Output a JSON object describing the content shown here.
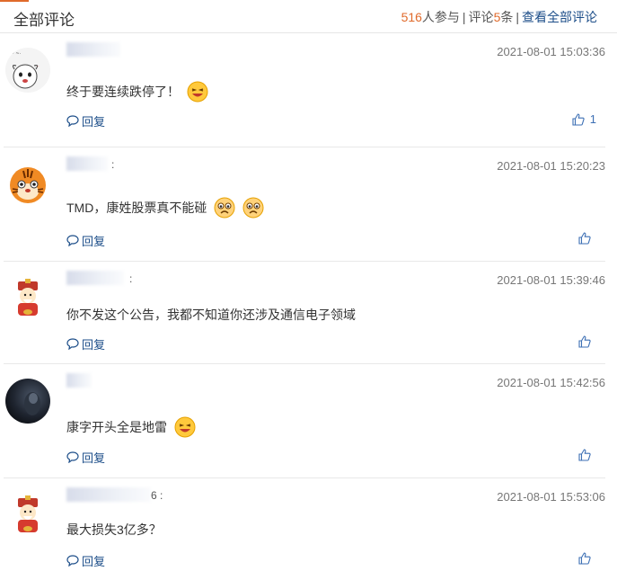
{
  "header": {
    "title": "全部评论",
    "participants": "516",
    "participants_suffix": "人参与",
    "separator": "|",
    "comments_prefix": "评论",
    "comments_count": "5",
    "comments_suffix": "条",
    "view_all": "查看全部评论",
    "accent_color": "#e06a2b",
    "link_color": "#1d4e89"
  },
  "comments": [
    {
      "time": "2021-08-01 15:03:36",
      "text": "终于要连续跌停了！",
      "reply": "回复",
      "likes": "1",
      "avatar": "dog-sticker-avatar",
      "emoji": "laughing-emoji"
    },
    {
      "time": "2021-08-01 15:20:23",
      "text": "TMD，康姓股票真不能碰",
      "reply": "回复",
      "likes": "",
      "avatar": "tiger-avatar",
      "emoji": "worried-emoji"
    },
    {
      "time": "2021-08-01 15:39:46",
      "text": "你不发这个公告，我都不知道你还涉及通信电子领域",
      "reply": "回复",
      "likes": "",
      "avatar": "fortune-god-avatar",
      "emoji": ""
    },
    {
      "time": "2021-08-01 15:42:56",
      "text": "康字开头全是地雷",
      "reply": "回复",
      "likes": "",
      "avatar": "dark-photo-avatar",
      "emoji": "laughing-emoji"
    },
    {
      "time": "2021-08-01 15:53:06",
      "text": "最大损失3亿多？",
      "reply": "回复",
      "likes": "",
      "avatar": "fortune-god-avatar",
      "emoji": ""
    }
  ]
}
